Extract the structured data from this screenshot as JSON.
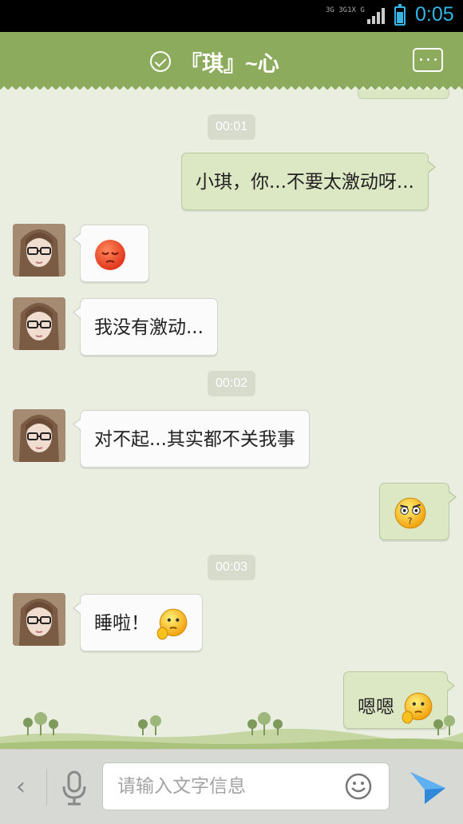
{
  "status_bar": {
    "signal_text_top": "3G 3G1X G",
    "time": "0:05",
    "battery_level": 0.7,
    "accent_color": "#33b5e5"
  },
  "header": {
    "contact_name": "『琪』~心",
    "status_icon": "check-circle-icon",
    "menu_icon": "more-dots-icon",
    "background_color": "#8cab5c"
  },
  "chat": {
    "timestamps": [
      "00:01",
      "00:02",
      "00:03"
    ],
    "messages": [
      {
        "direction": "out",
        "text": "小琪，你...不要太激动呀..."
      },
      {
        "direction": "in",
        "text": "",
        "emoji": "sad-face-emoji"
      },
      {
        "direction": "in",
        "text": "我没有激动..."
      },
      {
        "direction": "in",
        "text": "对不起...其实都不关我事"
      },
      {
        "direction": "out",
        "text": "",
        "emoji": "puzzled-face-emoji"
      },
      {
        "direction": "in",
        "text": "睡啦！",
        "emoji": "thinking-face-emoji"
      },
      {
        "direction": "out",
        "text": "嗯嗯",
        "emoji": "thinking-face-emoji"
      }
    ]
  },
  "input_bar": {
    "placeholder": "请输入文字信息",
    "back_icon": "chevron-left-icon",
    "voice_icon": "microphone-icon",
    "emoji_icon": "smiley-icon",
    "send_icon": "paper-plane-icon"
  }
}
